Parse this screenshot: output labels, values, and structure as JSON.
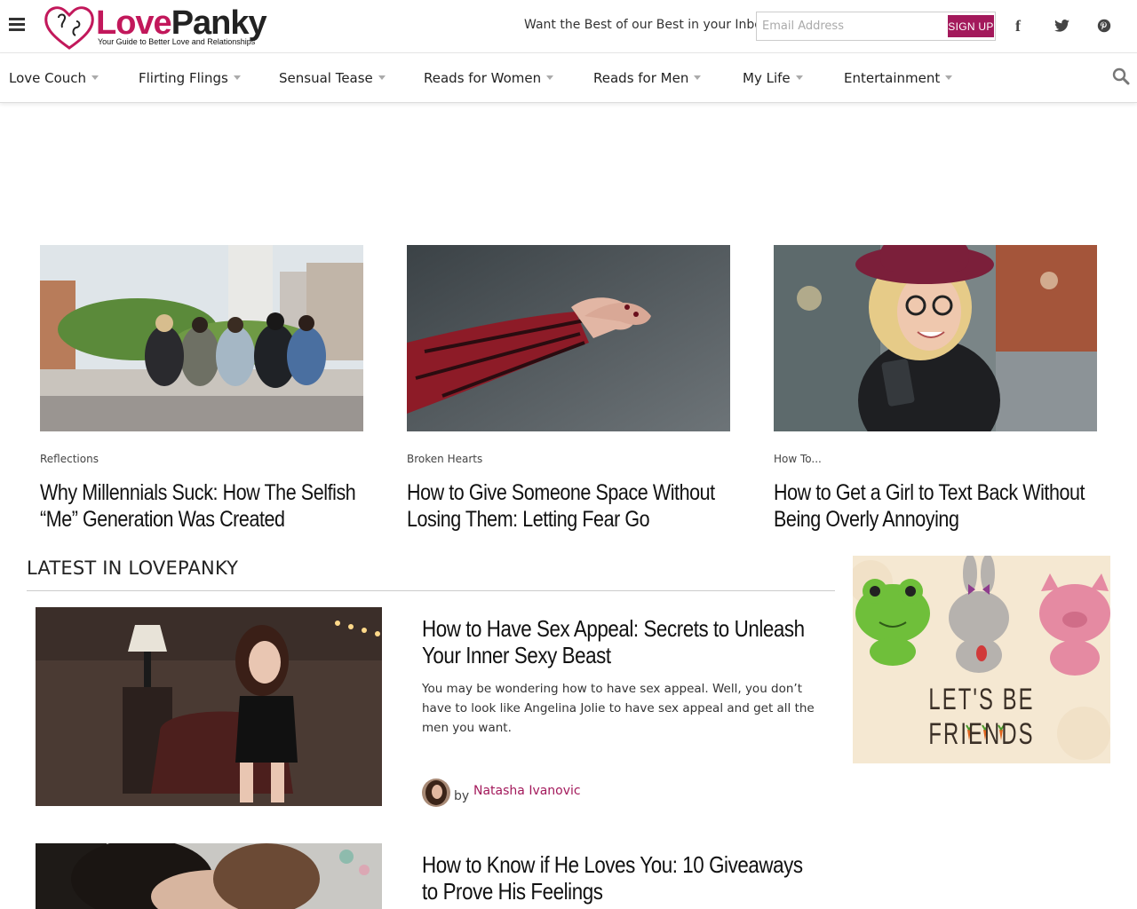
{
  "header": {
    "logo_love": "Love",
    "logo_panky": "Panky",
    "logo_tagline": "Your Guide to Better Love and Relationships",
    "newsletter_prompt": "Want the Best of our Best in your Inbox?",
    "email_placeholder": "Email Address",
    "signup_label": "SIGN UP",
    "social": [
      "facebook-icon",
      "twitter-icon",
      "pinterest-icon"
    ]
  },
  "nav": {
    "items": [
      {
        "label": "Love Couch"
      },
      {
        "label": "Flirting Flings"
      },
      {
        "label": "Sensual Tease"
      },
      {
        "label": "Reads for Women"
      },
      {
        "label": "Reads for Men"
      },
      {
        "label": "My Life"
      },
      {
        "label": "Entertainment"
      }
    ]
  },
  "featured": [
    {
      "category": "Reflections",
      "title": "Why Millennials Suck: How The Selfish “Me” Generation Was Created"
    },
    {
      "category": "Broken Hearts",
      "title": "How to Give Someone Space Without Losing Them: Letting Fear Go"
    },
    {
      "category": "How To...",
      "title": "How to Get a Girl to Text Back Without Being Overly Annoying"
    }
  ],
  "latest": {
    "heading": "LATEST IN LOVEPANKY",
    "posts": [
      {
        "title": "How to Have Sex Appeal: Secrets to Unleash Your Inner Sexy Beast",
        "excerpt": "You may be wondering how to have sex appeal. Well, you don’t have to look like Angelina Jolie to have sex appeal and get all the men you want.",
        "author_prefix": "by",
        "author": "Natasha Ivanovic"
      },
      {
        "title": "How to Know if He Loves You: 10 Giveaways to Prove His Feelings"
      }
    ]
  },
  "ad": {
    "text": "LET'S BE FRIENDS"
  },
  "colors": {
    "brand": "#a3195b",
    "logo_pink": "#c2185b"
  }
}
